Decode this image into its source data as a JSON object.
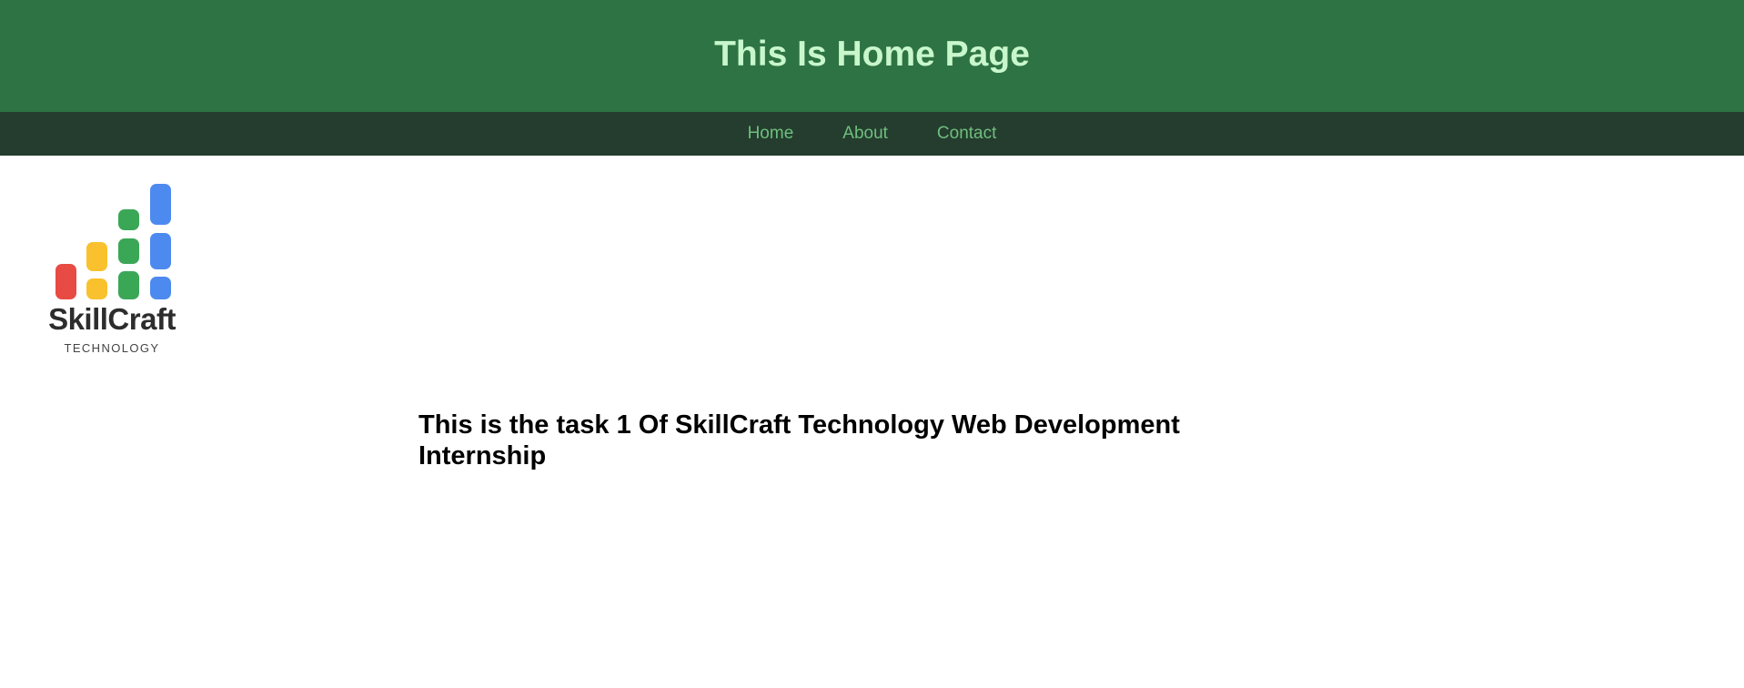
{
  "header": {
    "title": "This Is Home Page"
  },
  "nav": {
    "items": [
      {
        "label": "Home"
      },
      {
        "label": "About"
      },
      {
        "label": "Contact"
      }
    ]
  },
  "logo": {
    "wordmark": "SkillCraft",
    "tagline": "TECHNOLOGY",
    "colors": [
      "#e84b43",
      "#f9c12e",
      "#3aa757",
      "#4d8af0"
    ]
  },
  "main": {
    "heading": "This is the task 1 Of SkillCraft Technology Web Development Internship"
  },
  "colors": {
    "header_bg": "#2e7343",
    "header_text": "#c8f7cc",
    "nav_bg": "#243d2e",
    "nav_link": "#6fbf7e"
  }
}
